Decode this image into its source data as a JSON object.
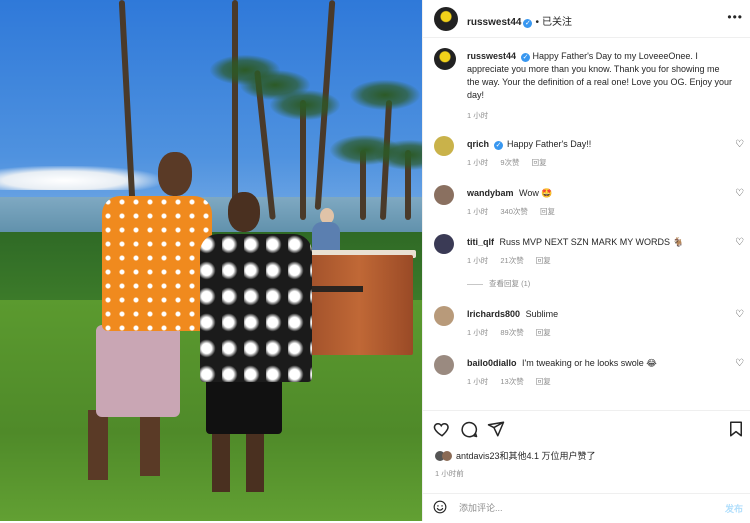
{
  "header": {
    "username": "russwest44",
    "follow_label": "已关注",
    "more_label": "•••"
  },
  "caption": {
    "username": "russwest44",
    "text": "Happy Father's Day to my LoveeeOnee. I appreciate you more than you know. Thank you for showing me the way. Your the definition of a real one! Love you OG. Enjoy your day!",
    "time": "1 小时"
  },
  "comments": [
    {
      "username": "qrich",
      "verified": true,
      "text": "Happy Father's Day!!",
      "time": "1 小时",
      "likes": "9次赞",
      "reply": "回复",
      "avatar_color": "#c9b24a"
    },
    {
      "username": "wandybam",
      "verified": false,
      "text": "Wow 🤩",
      "time": "1 小时",
      "likes": "340次赞",
      "reply": "回复",
      "avatar_color": "#8a7060"
    },
    {
      "username": "titi_qlf",
      "verified": false,
      "text": "Russ MVP NEXT SZN MARK MY WORDS 🐐",
      "time": "1 小时",
      "likes": "21次赞",
      "reply": "回复",
      "view_replies": "查看回复 (1)",
      "avatar_color": "#3a3a55"
    },
    {
      "username": "lrichards800",
      "verified": false,
      "text": "Sublime",
      "time": "1 小时",
      "likes": "89次赞",
      "reply": "回复",
      "avatar_color": "#b89a7a"
    },
    {
      "username": "bailo0diallo",
      "verified": false,
      "text": "I'm tweaking or he looks swole 😂",
      "time": "1 小时",
      "likes": "13次赞",
      "reply": "回复",
      "avatar_color": "#9a8a80"
    }
  ],
  "actions": {
    "liked_by": "antdavis23和其他4.1 万位用户赞了",
    "time_ago": "1 小时前"
  },
  "comment_box": {
    "placeholder": "添加评论...",
    "post_label": "发布"
  }
}
